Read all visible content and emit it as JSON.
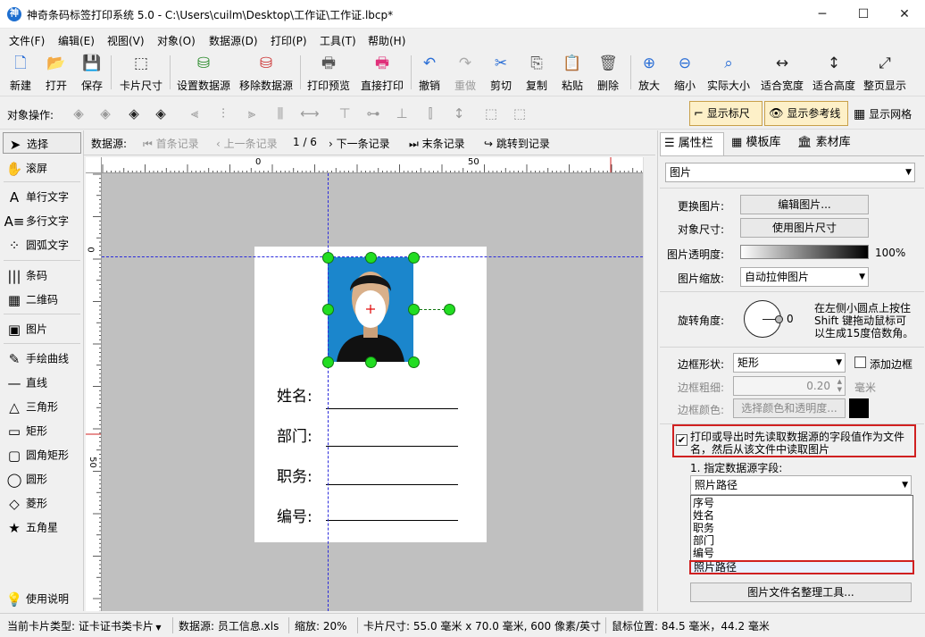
{
  "window": {
    "title": "神奇条码标签打印系统 5.0 - C:\\Users\\cuilm\\Desktop\\工作证\\工作证.lbcp*",
    "icon_letter": "神",
    "minimize": "─",
    "maximize": "☐",
    "close": "✕"
  },
  "menu": [
    "文件(F)",
    "编辑(E)",
    "视图(V)",
    "对象(O)",
    "数据源(D)",
    "打印(P)",
    "工具(T)",
    "帮助(H)"
  ],
  "toolbar": [
    {
      "label": "新建",
      "icon": "new-file-icon",
      "glyph": "🗋",
      "color": "#2a6ed6"
    },
    {
      "label": "打开",
      "icon": "open-file-icon",
      "glyph": "📂",
      "color": "#2a6ed6"
    },
    {
      "label": "保存",
      "icon": "save-icon",
      "glyph": "💾",
      "color": "#8a2a8a"
    },
    {
      "label": "卡片尺寸",
      "icon": "card-size-icon",
      "glyph": "⬚",
      "color": "#333333"
    },
    {
      "label": "设置数据源",
      "icon": "set-datasource-icon",
      "glyph": "⛁",
      "color": "#2a8a2a"
    },
    {
      "label": "移除数据源",
      "icon": "remove-datasource-icon",
      "glyph": "⛁",
      "color": "#cc3333"
    },
    {
      "label": "打印预览",
      "icon": "print-preview-icon",
      "glyph": "🖶",
      "color": "#555555"
    },
    {
      "label": "直接打印",
      "icon": "print-icon",
      "glyph": "🖶",
      "color": "#e0307a"
    },
    {
      "label": "撤销",
      "icon": "undo-icon",
      "glyph": "↶",
      "color": "#2a6ed6"
    },
    {
      "label": "重做",
      "icon": "redo-icon",
      "glyph": "↷",
      "color": "#aaaaaa"
    },
    {
      "label": "剪切",
      "icon": "cut-icon",
      "glyph": "✂",
      "color": "#2a6ed6"
    },
    {
      "label": "复制",
      "icon": "copy-icon",
      "glyph": "⎘",
      "color": "#555555"
    },
    {
      "label": "粘贴",
      "icon": "paste-icon",
      "glyph": "📋",
      "color": "#b07a2a"
    },
    {
      "label": "删除",
      "icon": "delete-icon",
      "glyph": "🗑",
      "color": "#555555"
    },
    {
      "label": "放大",
      "icon": "zoom-in-icon",
      "glyph": "⊕",
      "color": "#2a6ed6"
    },
    {
      "label": "缩小",
      "icon": "zoom-out-icon",
      "glyph": "⊖",
      "color": "#2a6ed6"
    },
    {
      "label": "实际大小",
      "icon": "actual-size-icon",
      "glyph": "⌕",
      "color": "#2a6ed6"
    },
    {
      "label": "适合宽度",
      "icon": "fit-width-icon",
      "glyph": "↔",
      "color": "#222222"
    },
    {
      "label": "适合高度",
      "icon": "fit-height-icon",
      "glyph": "↕",
      "color": "#222222"
    },
    {
      "label": "整页显示",
      "icon": "fit-page-icon",
      "glyph": "⤢",
      "color": "#222222"
    }
  ],
  "ops": {
    "label": "对象操作:",
    "show_ruler": "显示标尺",
    "show_guides": "显示参考线",
    "show_grid": "显示网格"
  },
  "tools": [
    {
      "label": "选择",
      "icon": "select-arrow-icon",
      "glyph": "➤"
    },
    {
      "label": "滚屏",
      "icon": "hand-scroll-icon",
      "glyph": "✋"
    },
    {
      "label": "单行文字",
      "icon": "single-line-text-icon",
      "glyph": "A"
    },
    {
      "label": "多行文字",
      "icon": "multi-line-text-icon",
      "glyph": "A≡"
    },
    {
      "label": "圆弧文字",
      "icon": "arc-text-icon",
      "glyph": "⁘"
    },
    {
      "label": "条码",
      "icon": "barcode-icon",
      "glyph": "|||"
    },
    {
      "label": "二维码",
      "icon": "qrcode-icon",
      "glyph": "▦"
    },
    {
      "label": "图片",
      "icon": "image-icon",
      "glyph": "▣"
    },
    {
      "label": "手绘曲线",
      "icon": "freehand-icon",
      "glyph": "✎"
    },
    {
      "label": "直线",
      "icon": "line-icon",
      "glyph": "—"
    },
    {
      "label": "三角形",
      "icon": "triangle-icon",
      "glyph": "△"
    },
    {
      "label": "矩形",
      "icon": "rectangle-icon",
      "glyph": "▭"
    },
    {
      "label": "圆角矩形",
      "icon": "rounded-rect-icon",
      "glyph": "▢"
    },
    {
      "label": "圆形",
      "icon": "circle-icon",
      "glyph": "◯"
    },
    {
      "label": "菱形",
      "icon": "diamond-icon",
      "glyph": "◇"
    },
    {
      "label": "五角星",
      "icon": "star-icon",
      "glyph": "★"
    },
    {
      "label": "使用说明",
      "icon": "help-bulb-icon",
      "glyph": "💡"
    }
  ],
  "nav": {
    "label": "数据源:",
    "first": "首条记录",
    "prev": "上一条记录",
    "position": "1 / 6",
    "next": "下一条记录",
    "last": "末条记录",
    "jump": "跳转到记录"
  },
  "ruler": {
    "h_ticks": [
      "0",
      "50"
    ],
    "v_ticks": [
      "0",
      "50"
    ]
  },
  "card": {
    "fields": [
      "姓名:",
      "部门:",
      "职务:",
      "编号:"
    ]
  },
  "panel": {
    "tabs": [
      "属性栏",
      "模板库",
      "素材库"
    ],
    "object_type": "图片",
    "change_image_label": "更换图片:",
    "edit_image_btn": "编辑图片...",
    "object_size_label": "对象尺寸:",
    "use_image_size_btn": "使用图片尺寸",
    "opacity_label": "图片透明度:",
    "opacity_value": "100%",
    "scale_label": "图片缩放:",
    "scale_value": "自动拉伸图片",
    "rotation_label": "旋转角度:",
    "rotation_value": "0",
    "rotation_hint": [
      "在左侧小圆点上按住",
      "Shift 键拖动鼠标可",
      "以生成15度倍数角。"
    ],
    "border_shape_label": "边框形状:",
    "border_shape_value": "矩形",
    "add_border_label": "添加边框",
    "border_width_label": "边框粗细:",
    "border_width_value": "0.20",
    "border_width_unit": "毫米",
    "border_color_label": "边框颜色:",
    "border_color_btn": "选择颜色和透明度...",
    "read_from_ds_line1": "打印或导出时先读取数据源的字段值作为文件",
    "read_from_ds_line2": "名，然后从该文件中读取图片",
    "specify_field_label": "1. 指定数据源字段:",
    "field_value": "照片路径",
    "field_options": [
      "序号",
      "姓名",
      "职务",
      "部门",
      "编号",
      "照片路径"
    ],
    "organize_tool_btn": "图片文件名整理工具..."
  },
  "status": {
    "card_type": "当前卡片类型: 证卡证书类卡片",
    "datasource": "数据源: 员工信息.xls",
    "zoom": "缩放: 20%",
    "card_size": "卡片尺寸: 55.0 毫米 x 70.0 毫米, 600 像素/英寸",
    "mouse_pos": "鼠标位置: 84.5 毫米，44.2 毫米"
  }
}
